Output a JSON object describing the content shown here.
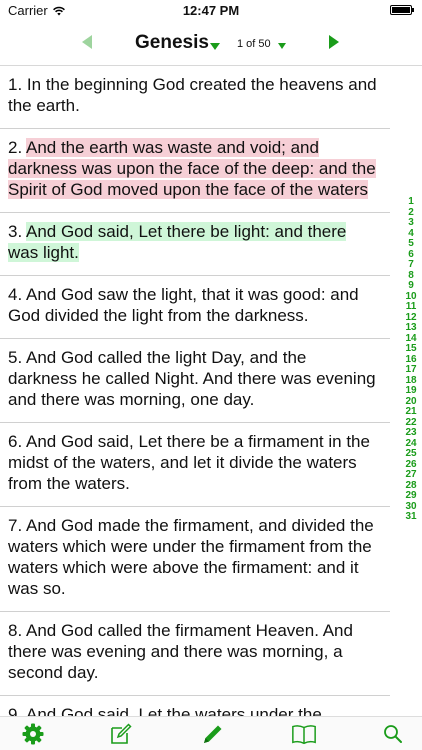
{
  "status": {
    "carrier": "Carrier",
    "time": "12:47 PM"
  },
  "nav": {
    "book": "Genesis",
    "chapter_indicator": "1 of 50"
  },
  "verses": [
    {
      "number": "1.",
      "text": "In the beginning God created the heavens and the earth.",
      "highlight": "none"
    },
    {
      "number": "2.",
      "text": "And the earth was waste and void; and darkness was upon the face of the deep: and the Spirit of God moved upon the face of the waters",
      "highlight": "red"
    },
    {
      "number": "3.",
      "text": "And God said, Let there be light: and there was light.",
      "highlight": "green"
    },
    {
      "number": "4.",
      "text": "And God saw the light, that it was good: and God divided the light from the darkness.",
      "highlight": "none"
    },
    {
      "number": "5.",
      "text": "And God called the light Day, and the darkness he called Night. And there was evening and there was morning, one day.",
      "highlight": "none"
    },
    {
      "number": "6.",
      "text": "And God said, Let there be a firmament in the midst of the waters, and let it divide the waters from the waters.",
      "highlight": "none"
    },
    {
      "number": "7.",
      "text": "And God made the firmament, and divided the waters which were under the firmament from the waters which were above the firmament: and it was so.",
      "highlight": "none"
    },
    {
      "number": "8.",
      "text": "And God called the firmament Heaven. And there was evening and there was morning, a second day.",
      "highlight": "none"
    },
    {
      "number": "9.",
      "text": "And God said, Let the waters under the",
      "highlight": "none"
    }
  ],
  "verse_index": [
    "1",
    "2",
    "3",
    "4",
    "5",
    "6",
    "7",
    "8",
    "9",
    "10",
    "11",
    "12",
    "13",
    "14",
    "15",
    "16",
    "17",
    "18",
    "19",
    "20",
    "21",
    "22",
    "23",
    "24",
    "25",
    "26",
    "27",
    "28",
    "29",
    "30",
    "31"
  ],
  "tabs": [
    {
      "name": "settings",
      "icon": "gear-icon"
    },
    {
      "name": "notes",
      "icon": "compose-icon"
    },
    {
      "name": "highlight",
      "icon": "pencil-icon"
    },
    {
      "name": "bookmarks",
      "icon": "book-icon"
    },
    {
      "name": "search",
      "icon": "search-icon"
    }
  ],
  "colors": {
    "accent": "#1a9c1a",
    "highlight_red": "#f6cfd6",
    "highlight_green": "#cff6d8"
  }
}
